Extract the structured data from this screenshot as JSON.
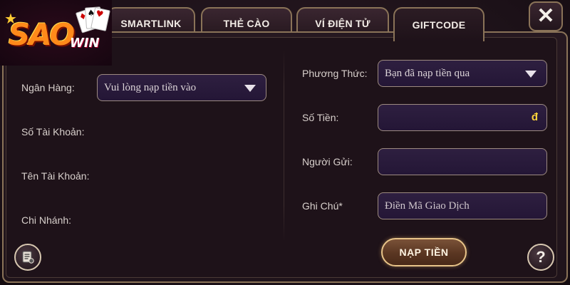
{
  "brand": {
    "logo_text": "SAO",
    "logo_subtext": "WIN"
  },
  "tabs": [
    {
      "label": "SMARTLINK"
    },
    {
      "label": "THẺ CÀO"
    },
    {
      "label": "VÍ ĐIỆN TỬ"
    },
    {
      "label": "GIFTCODE"
    }
  ],
  "close_label": "✕",
  "left_form": {
    "bank_label": "Ngân Hàng:",
    "bank_select_value": "Vui lòng nạp tiền vào",
    "account_number_label": "Số Tài Khoản:",
    "account_name_label": "Tên Tài Khoản:",
    "branch_label": "Chi Nhánh:"
  },
  "right_form": {
    "method_label": "Phương Thức:",
    "method_select_value": "Bạn đã nạp tiền qua",
    "amount_label": "Số Tiền:",
    "amount_suffix": "đ",
    "sender_label": "Người Gửi:",
    "note_label": "Ghi Chú*",
    "note_placeholder": "Điền Mã Giao Dịch"
  },
  "submit_label": "NẠP TIỀN",
  "help_label": "?",
  "icons": {
    "history": "history-icon",
    "help": "help-icon",
    "close": "close-icon",
    "dropdown": "chevron-down-icon"
  },
  "colors": {
    "accent_gold": "#8a7358",
    "field_bg": "#2a1c3c",
    "currency_yellow": "#ffd23a"
  }
}
